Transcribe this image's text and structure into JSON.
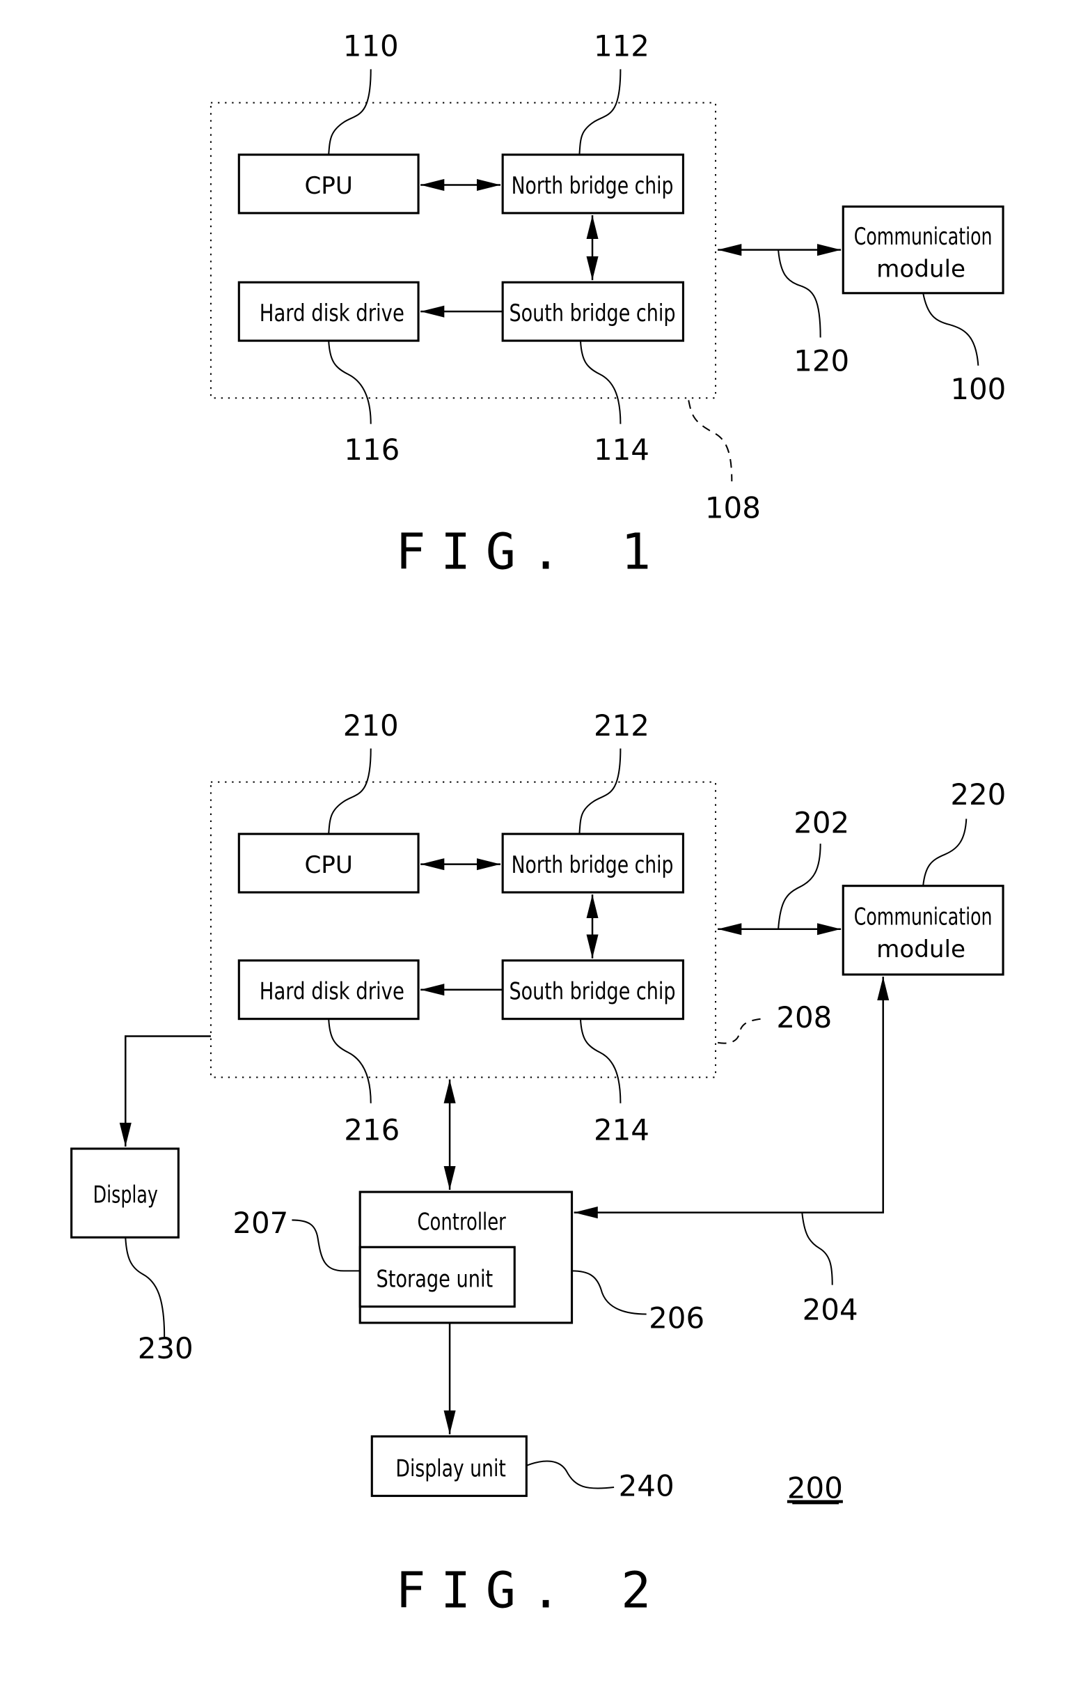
{
  "fig1": {
    "caption": "FIG. 1",
    "blocks": {
      "cpu": "CPU",
      "north_bridge": "North bridge chip",
      "south_bridge": "South bridge chip",
      "hdd": "Hard disk drive",
      "comm_line1": "Communication",
      "comm_line2": "module"
    },
    "refs": {
      "cpu": "110",
      "north_bridge": "112",
      "south_bridge": "114",
      "hdd": "116",
      "computer": "108",
      "link": "120",
      "comm": "100"
    }
  },
  "fig2": {
    "caption": "FIG. 2",
    "system_ref": "200",
    "blocks": {
      "cpu": "CPU",
      "north_bridge": "North bridge chip",
      "south_bridge": "South bridge chip",
      "hdd": "Hard disk drive",
      "comm_line1": "Communication",
      "comm_line2": "module",
      "display": "Display",
      "controller": "Controller",
      "storage": "Storage unit",
      "display_unit": "Display unit"
    },
    "refs": {
      "cpu": "210",
      "north_bridge": "212",
      "south_bridge": "214",
      "hdd": "216",
      "computer": "208",
      "link": "202",
      "comm": "220",
      "display": "230",
      "storage": "207",
      "controller": "206",
      "ctrl_link": "204",
      "display_unit": "240"
    }
  }
}
